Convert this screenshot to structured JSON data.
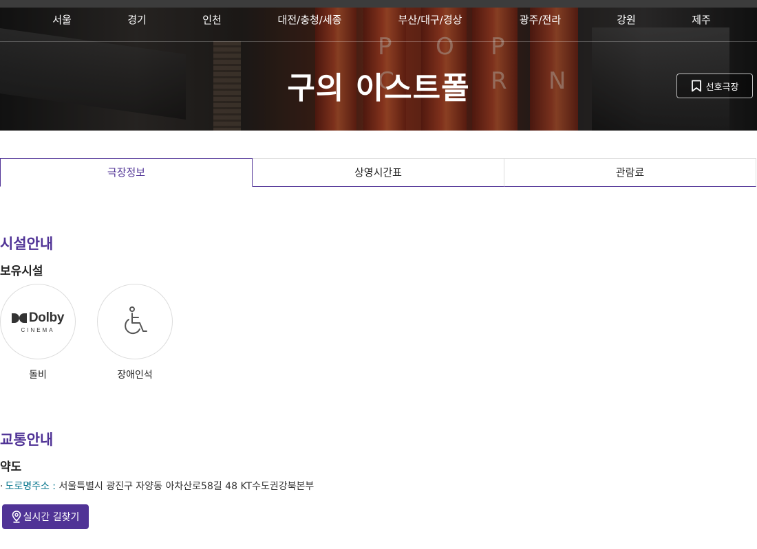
{
  "regions": [
    "서울",
    "경기",
    "인천",
    "대전/충청/세종",
    "부산/대구/경상",
    "광주/전라",
    "강원",
    "제주"
  ],
  "theater": {
    "title": "구의 이스트폴",
    "favorite_label": "선호극장",
    "background_letters": [
      "P",
      "O",
      "P",
      "N",
      "R",
      "C"
    ]
  },
  "tabs": [
    {
      "label": "극장정보",
      "active": true
    },
    {
      "label": "상영시간표",
      "active": false
    },
    {
      "label": "관람료",
      "active": false
    }
  ],
  "facilities_section": {
    "title": "시설안내",
    "subtitle": "보유시설",
    "items": [
      {
        "icon": "dolby-cinema-logo",
        "logo_text": "Dolby",
        "logo_sub": "CINEMA",
        "label": "돌비"
      },
      {
        "icon": "wheelchair-icon",
        "label": "장애인석"
      }
    ]
  },
  "transport_section": {
    "title": "교통안내",
    "subtitle": "약도",
    "address_label": "도로명주소 :",
    "address": "서울특별시 광진구 자양동 아차산로58길 48 KT수도권강북본부",
    "route_button": "실시간 길찾기"
  },
  "colors": {
    "accent": "#503396",
    "address_label": "#01738b",
    "nav_text": "#ffffff"
  }
}
